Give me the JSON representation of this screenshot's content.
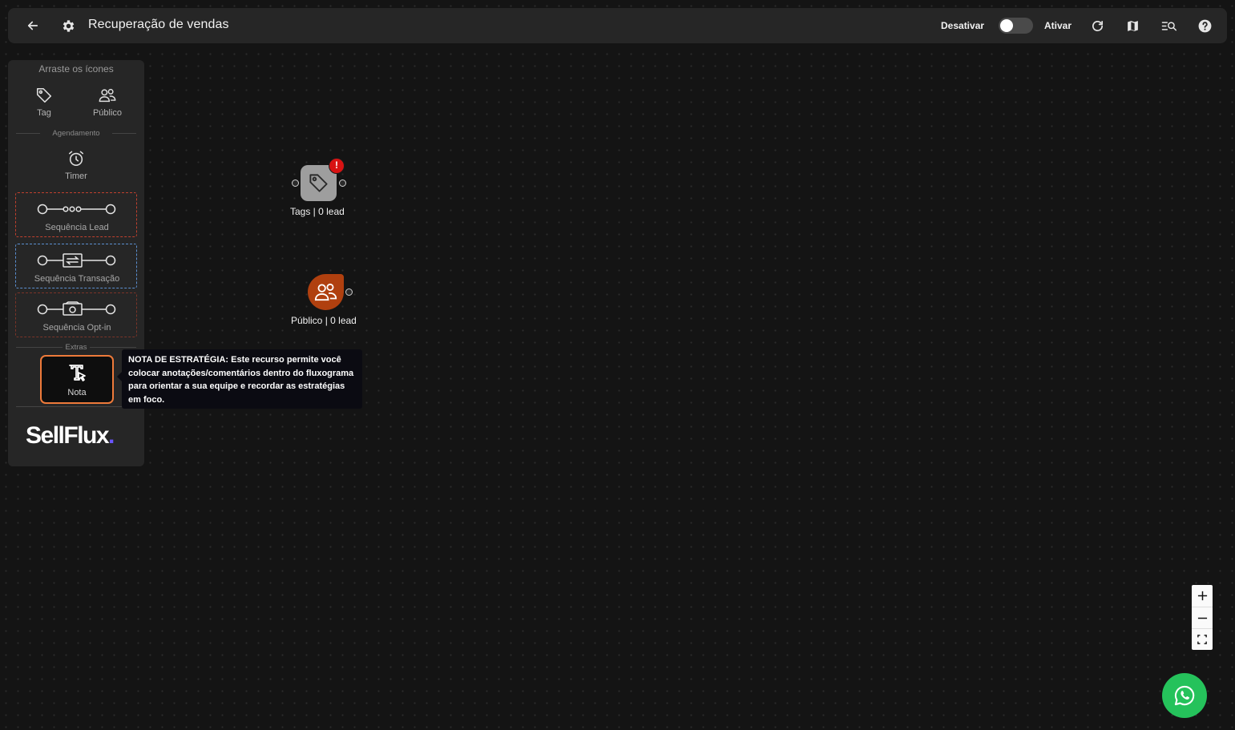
{
  "header": {
    "title": "Recuperação de vendas",
    "deactivate_label": "Desativar",
    "activate_label": "Ativar",
    "toggle_active": false
  },
  "sidebar": {
    "heading": "Arraste os ícones",
    "tools": {
      "tag": "Tag",
      "publico": "Público",
      "timer": "Timer",
      "nota": "Nota"
    },
    "sections": {
      "agendamento": "Agendamento",
      "extras": "Extras"
    },
    "sequences": [
      {
        "label": "Sequência Lead",
        "border": "#c0402e"
      },
      {
        "label": "Sequência Transação",
        "border": "#5b8fd0"
      },
      {
        "label": "Sequência Opt-in",
        "border": "#9a3a2a"
      }
    ],
    "logo": {
      "text": "SellFlux",
      "dot": "."
    }
  },
  "tooltip": {
    "text": "NOTA DE ESTRATÉGIA: Este recurso permite você colocar anotações/comentários dentro do fluxograma para orientar a sua equipe e recordar as estratégias em foco."
  },
  "nodes": {
    "tags": {
      "label": "Tags | 0 lead",
      "alert": "!"
    },
    "publico": {
      "label": "Público | 0 lead"
    }
  },
  "colors": {
    "accent_orange": "#ee7a3a",
    "publico_node": "#b0400f",
    "alert_red": "#d81313",
    "whatsapp": "#25c25b"
  },
  "icons": [
    "arrow-left-icon",
    "gear-icon",
    "refresh-icon",
    "map-icon",
    "search-list-icon",
    "help-icon",
    "tag-icon",
    "users-icon",
    "alarm-clock-icon",
    "text-cursor-icon",
    "whatsapp-icon",
    "plus-icon",
    "minus-icon",
    "fullscreen-icon"
  ]
}
